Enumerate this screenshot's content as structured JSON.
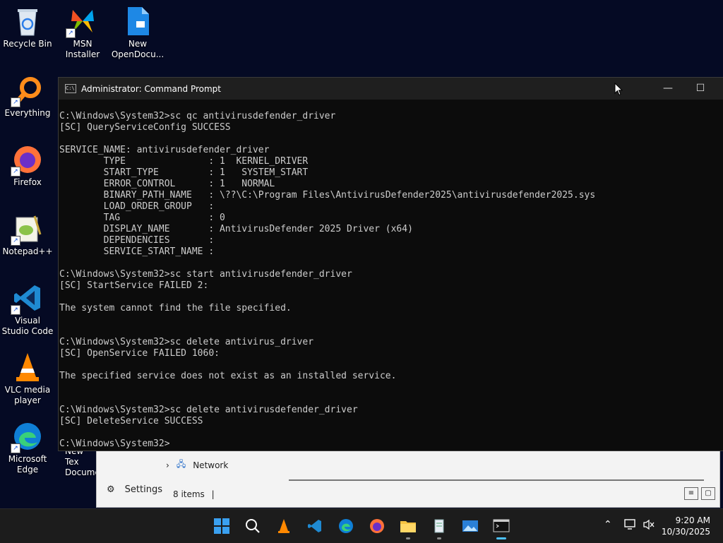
{
  "desktop": {
    "icons": [
      {
        "label": "Recycle Bin"
      },
      {
        "label": "MSN Installer"
      },
      {
        "label": "New OpenDocu..."
      },
      {
        "label": "Everything"
      },
      {
        "label": "Firefox"
      },
      {
        "label": "Notepad++"
      },
      {
        "label": "Visual Studio Code"
      },
      {
        "label": "VLC media player"
      },
      {
        "label": "Microsoft Edge"
      },
      {
        "label": "New Tex Docume"
      }
    ]
  },
  "explorer": {
    "nav_item": "Network",
    "settings_label": "Settings",
    "status": "8 items"
  },
  "cmd_window": {
    "title": "Administrator: Command Prompt",
    "minimize": "—",
    "maximize": "☐",
    "lines": [
      "C:\\Windows\\System32>sc qc antivirusdefender_driver",
      "[SC] QueryServiceConfig SUCCESS",
      "",
      "SERVICE_NAME: antivirusdefender_driver",
      "        TYPE               : 1  KERNEL_DRIVER",
      "        START_TYPE         : 1   SYSTEM_START",
      "        ERROR_CONTROL      : 1   NORMAL",
      "        BINARY_PATH_NAME   : \\??\\C:\\Program Files\\AntivirusDefender2025\\antivirusdefender2025.sys",
      "        LOAD_ORDER_GROUP   :",
      "        TAG                : 0",
      "        DISPLAY_NAME       : AntivirusDefender 2025 Driver (x64)",
      "        DEPENDENCIES       :",
      "        SERVICE_START_NAME :",
      "",
      "C:\\Windows\\System32>sc start antivirusdefender_driver",
      "[SC] StartService FAILED 2:",
      "",
      "The system cannot find the file specified.",
      "",
      "",
      "C:\\Windows\\System32>sc delete antivirus_driver",
      "[SC] OpenService FAILED 1060:",
      "",
      "The specified service does not exist as an installed service.",
      "",
      "",
      "C:\\Windows\\System32>sc delete antivirusdefender_driver",
      "[SC] DeleteService SUCCESS",
      "",
      "C:\\Windows\\System32>"
    ]
  },
  "taskbar": {
    "time": "9:20 AM",
    "date": "10/30/2025",
    "apps": [
      "start-icon",
      "search-icon",
      "vlc-icon",
      "vscode-icon",
      "edge-icon",
      "firefox-icon",
      "file-explorer-icon",
      "notepad-icon",
      "photos-icon",
      "terminal-icon"
    ]
  },
  "colors": {
    "console_bg": "#0c0c0c",
    "console_text": "#cccccc",
    "accent": "#4cc2ff"
  }
}
